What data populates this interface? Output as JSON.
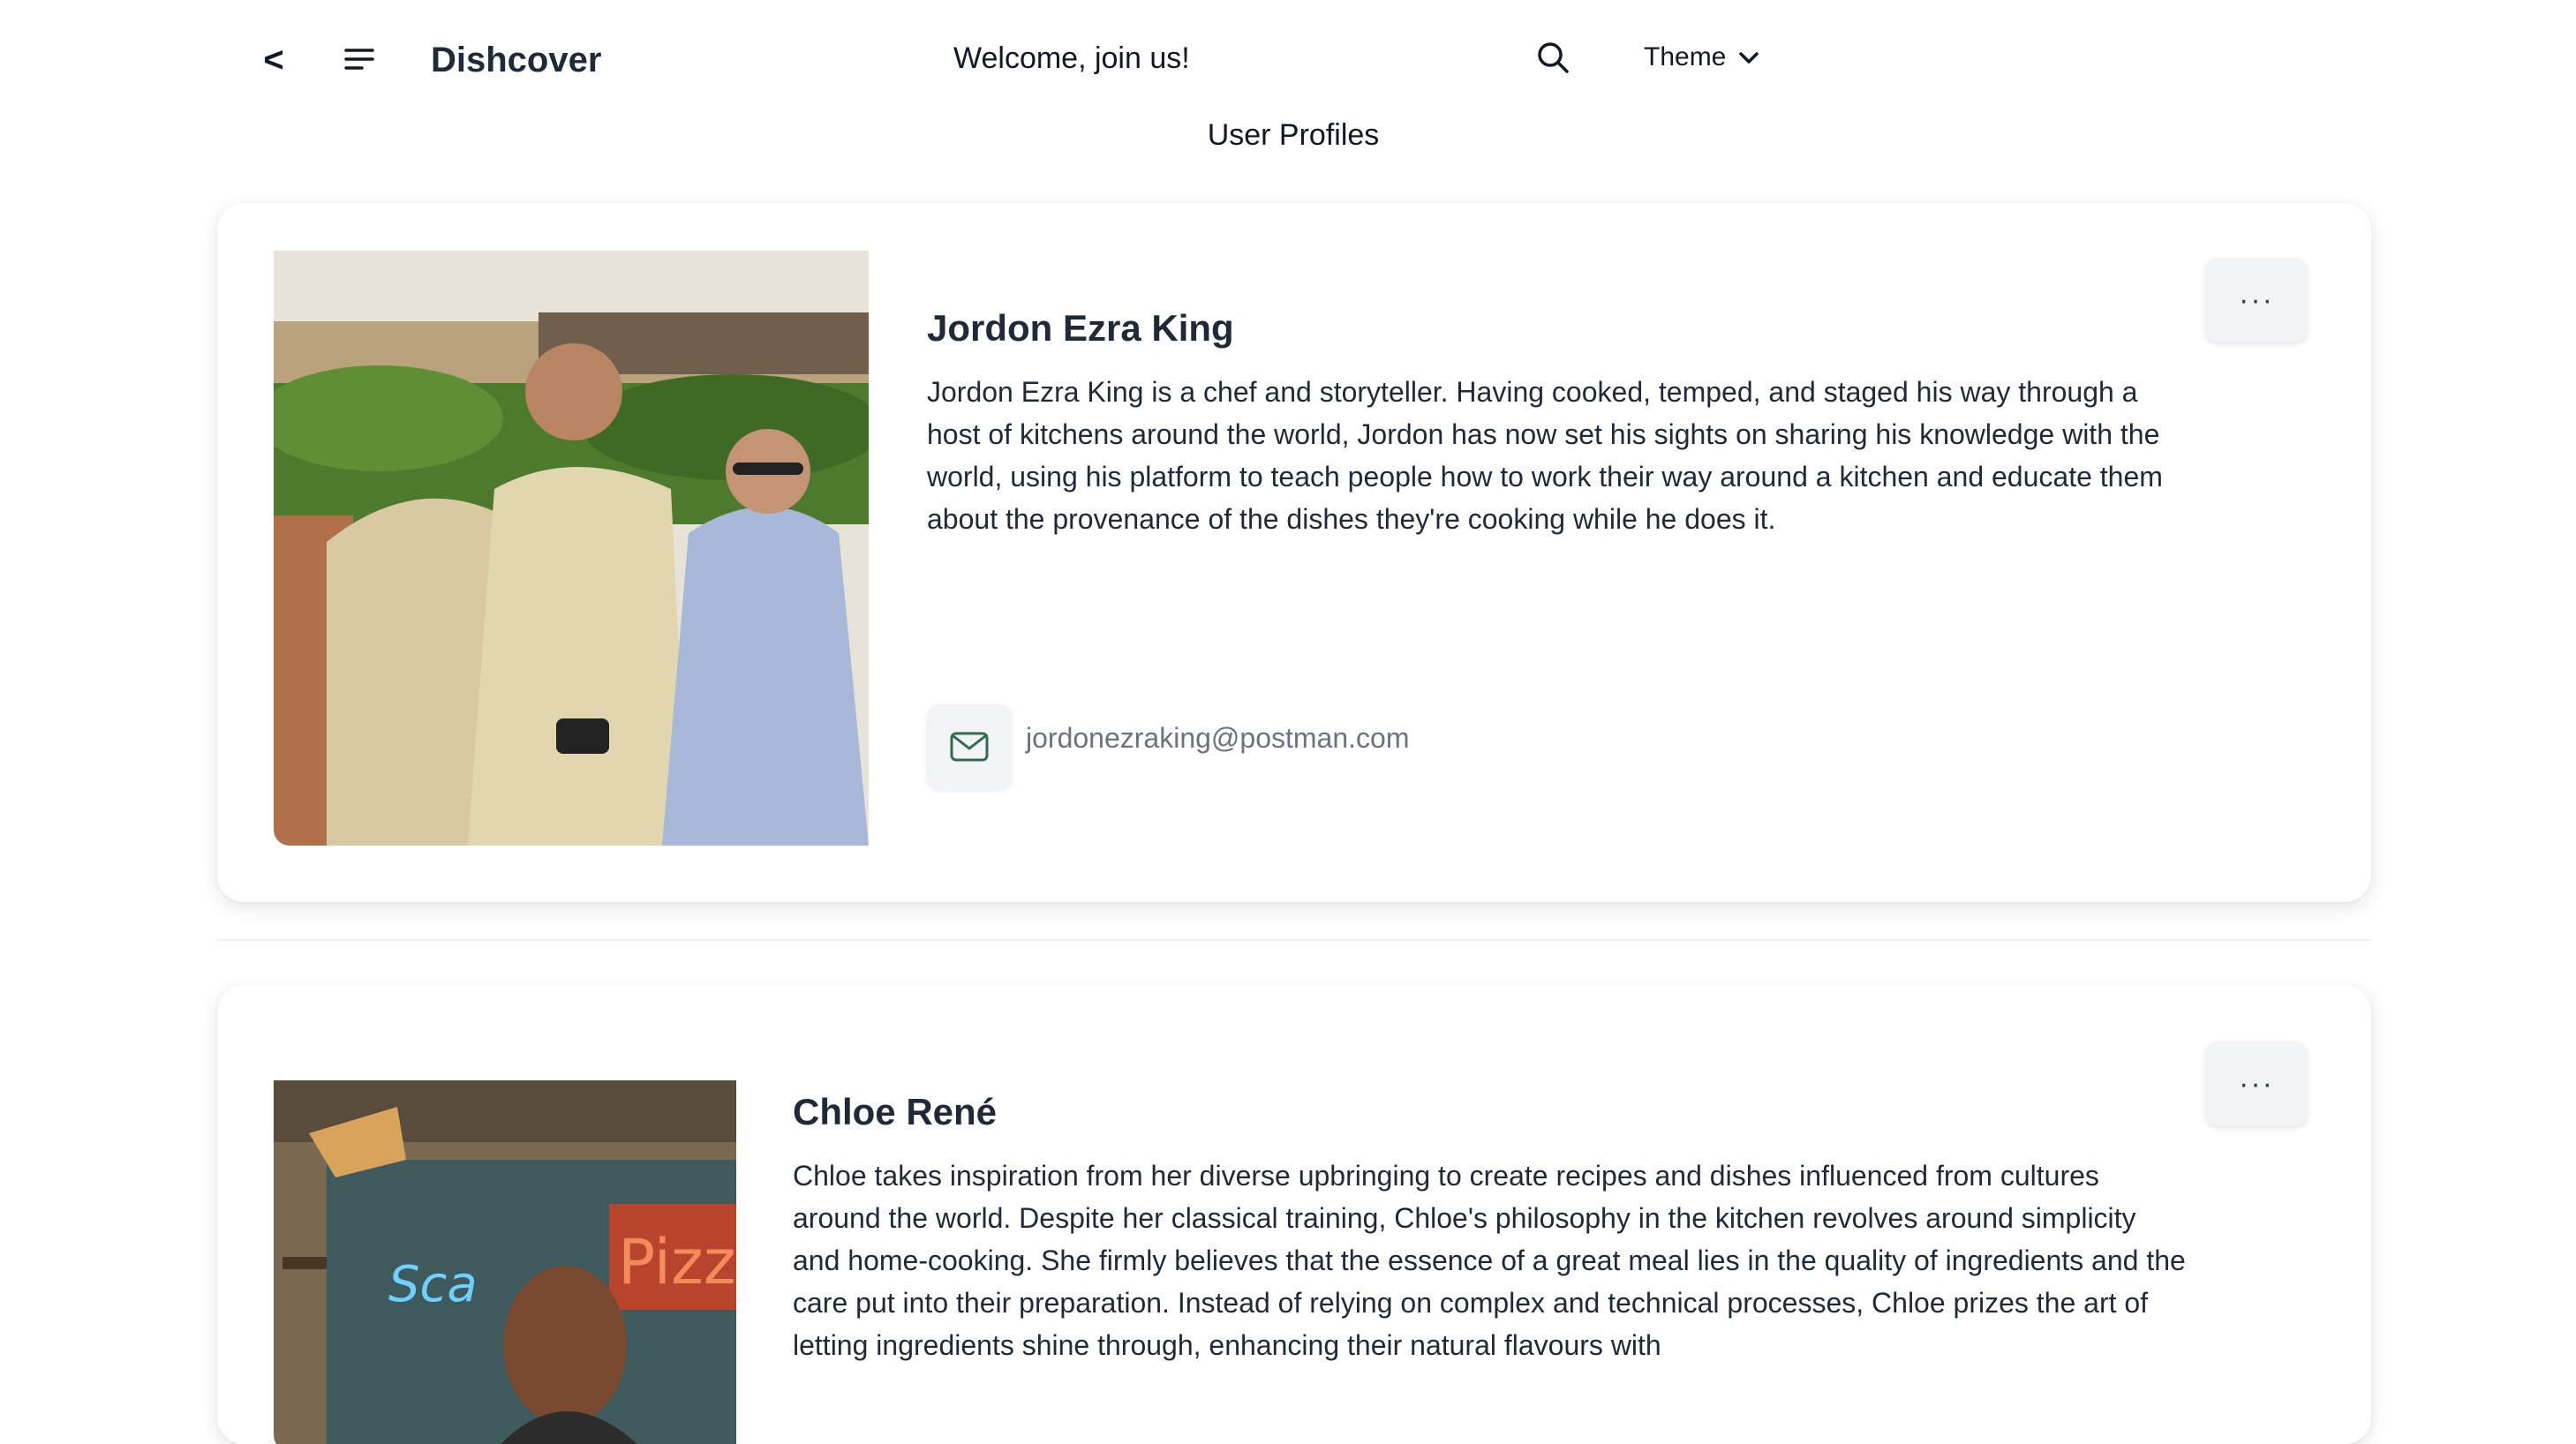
{
  "header": {
    "back_label": "<",
    "app_title": "Dishcover",
    "welcome": "Welcome, join us!",
    "theme_label": "Theme"
  },
  "page": {
    "title": "User Profiles"
  },
  "profiles": [
    {
      "name": "Jordon Ezra King",
      "bio": "Jordon Ezra King is a chef and storyteller. Having cooked, temped, and staged his way through a host of kitchens around the world, Jordon has now set his sights on sharing his knowledge with the world, using his platform to teach people how to work their way around a kitchen and educate them about the provenance of the dishes they're cooking while he does it.",
      "email": "jordonezraking@postman.com",
      "more_label": "···"
    },
    {
      "name": "Chloe René",
      "bio": "Chloe takes inspiration from her diverse upbringing to create recipes and dishes influenced from cultures around the world. Despite her classical training, Chloe's philosophy in the kitchen revolves around simplicity and home-cooking. She firmly believes that the essence of a great meal lies in the quality of ingredients and the care put into their preparation. Instead of relying on complex and technical processes, Chloe prizes the art of letting ingredients shine through, enhancing their natural flavours with",
      "more_label": "···"
    }
  ],
  "icons": {
    "menu": "menu-lines-icon",
    "search": "search-icon",
    "chevron": "chevron-down-icon",
    "mail": "mail-icon",
    "more": "more-horizontal-icon"
  },
  "colors": {
    "text": "#1f2937",
    "muted": "#6b7280",
    "button_bg": "#f2f3f5",
    "mail_icon": "#2f6b4f"
  }
}
